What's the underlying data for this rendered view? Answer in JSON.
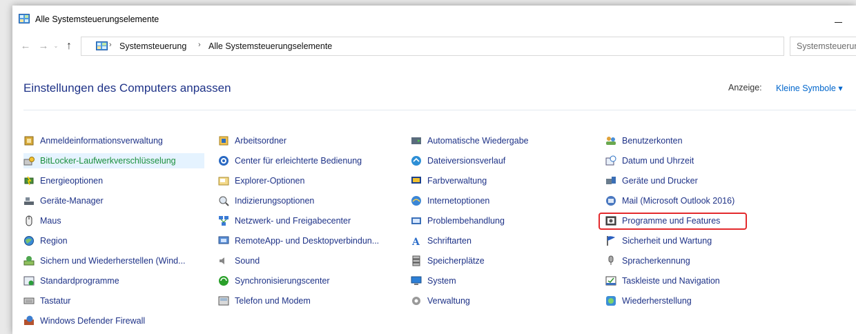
{
  "window": {
    "title": "Alle Systemsteuerungselemente"
  },
  "address_bar": {
    "breadcrumbs": [
      "Systemsteuerung",
      "Alle Systemsteuerungselemente"
    ],
    "separator": "›",
    "search_placeholder": "Systemsteuerung durchsuchen"
  },
  "nav": {
    "back": "←",
    "forward": "→",
    "recent": "⌄",
    "up": "↑",
    "dropdown": "⌄",
    "refresh": "↻"
  },
  "header": {
    "title": "Einstellungen des Computers anpassen",
    "view_label": "Anzeige:",
    "view_value": "Kleine Symbole ▾"
  },
  "columns": [
    [
      {
        "label": "Anmeldeinformationsverwaltung",
        "icon": "credential-manager-icon"
      },
      {
        "label": "BitLocker-Laufwerkverschlüsselung",
        "icon": "bitlocker-icon",
        "hovered": true
      },
      {
        "label": "Energieoptionen",
        "icon": "power-options-icon"
      },
      {
        "label": "Geräte-Manager",
        "icon": "device-manager-icon"
      },
      {
        "label": "Maus",
        "icon": "mouse-icon"
      },
      {
        "label": "Region",
        "icon": "region-icon"
      },
      {
        "label": "Sichern und Wiederherstellen (Wind...",
        "icon": "backup-restore-icon"
      },
      {
        "label": "Standardprogramme",
        "icon": "default-programs-icon"
      },
      {
        "label": "Tastatur",
        "icon": "keyboard-icon"
      },
      {
        "label": "Windows Defender Firewall",
        "icon": "firewall-icon"
      }
    ],
    [
      {
        "label": "Arbeitsordner",
        "icon": "work-folders-icon"
      },
      {
        "label": "Center für erleichterte Bedienung",
        "icon": "ease-of-access-icon"
      },
      {
        "label": "Explorer-Optionen",
        "icon": "explorer-options-icon"
      },
      {
        "label": "Indizierungsoptionen",
        "icon": "indexing-options-icon"
      },
      {
        "label": "Netzwerk- und Freigabecenter",
        "icon": "network-center-icon"
      },
      {
        "label": "RemoteApp- und Desktopverbindun...",
        "icon": "remoteapp-icon"
      },
      {
        "label": "Sound",
        "icon": "sound-icon"
      },
      {
        "label": "Synchronisierungscenter",
        "icon": "sync-center-icon"
      },
      {
        "label": "Telefon und Modem",
        "icon": "phone-modem-icon"
      }
    ],
    [
      {
        "label": "Automatische Wiedergabe",
        "icon": "autoplay-icon"
      },
      {
        "label": "Dateiversionsverlauf",
        "icon": "file-history-icon"
      },
      {
        "label": "Farbverwaltung",
        "icon": "color-management-icon"
      },
      {
        "label": "Internetoptionen",
        "icon": "internet-options-icon"
      },
      {
        "label": "Problembehandlung",
        "icon": "troubleshooting-icon"
      },
      {
        "label": "Schriftarten",
        "icon": "fonts-icon"
      },
      {
        "label": "Speicherplätze",
        "icon": "storage-spaces-icon"
      },
      {
        "label": "System",
        "icon": "system-icon"
      },
      {
        "label": "Verwaltung",
        "icon": "administrative-tools-icon"
      }
    ],
    [
      {
        "label": "Benutzerkonten",
        "icon": "user-accounts-icon"
      },
      {
        "label": "Datum und Uhrzeit",
        "icon": "date-time-icon"
      },
      {
        "label": "Geräte und Drucker",
        "icon": "devices-printers-icon"
      },
      {
        "label": "Mail (Microsoft Outlook 2016)",
        "icon": "mail-icon"
      },
      {
        "label": "Programme und Features",
        "icon": "programs-features-icon",
        "highlighted": true
      },
      {
        "label": "Sicherheit und Wartung",
        "icon": "security-maintenance-icon"
      },
      {
        "label": "Spracherkennung",
        "icon": "speech-recognition-icon"
      },
      {
        "label": "Taskleiste und Navigation",
        "icon": "taskbar-navigation-icon"
      },
      {
        "label": "Wiederherstellung",
        "icon": "recovery-icon"
      }
    ]
  ],
  "colors": {
    "link": "#1e3287",
    "hover_text": "#1b8f3c",
    "hover_bg": "#e5f3ff",
    "highlight_border": "#e3292c"
  }
}
